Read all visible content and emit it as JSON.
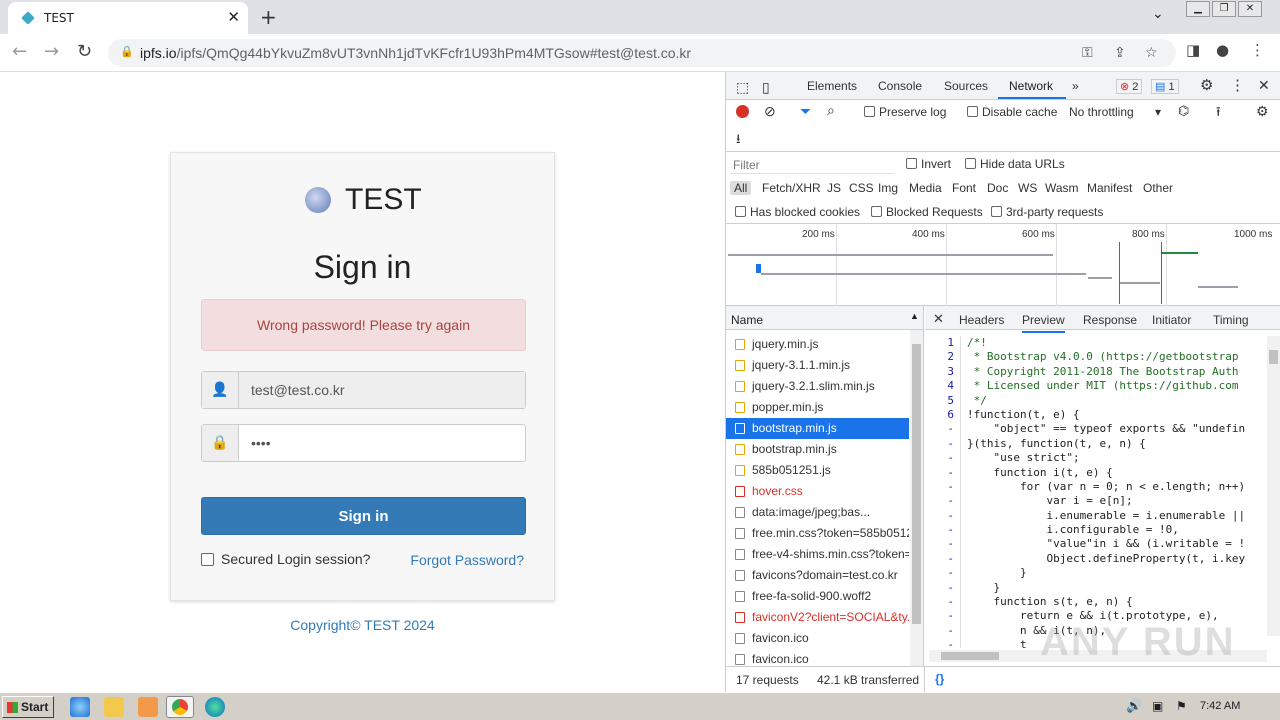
{
  "browser": {
    "tab_title": "TEST",
    "url_host": "ipfs.io",
    "url_path": "/ipfs/QmQg44bYkvuZm8vUT3vnNh1jdTvKFcfr1U93hPm4MTGsow#test@test.co.kr"
  },
  "login": {
    "brand": "TEST",
    "heading": "Sign in",
    "alert": "Wrong password! Please try again",
    "email_value": "test@test.co.kr",
    "password_mask": "••••",
    "signin_label": "Sign in",
    "remember_label": "Secured Login session?",
    "forgot_label": "Forgot Password?",
    "copyright": "Copyright© TEST 2024"
  },
  "devtools": {
    "tabs": [
      "Elements",
      "Console",
      "Sources",
      "Network"
    ],
    "error_count": "2",
    "message_count": "1",
    "preserve_log": "Preserve log",
    "disable_cache": "Disable cache",
    "throttling": "No throttling",
    "filter_placeholder": "Filter",
    "invert": "Invert",
    "hide_data_urls": "Hide data URLs",
    "type_filters": [
      "All",
      "Fetch/XHR",
      "JS",
      "CSS",
      "Img",
      "Media",
      "Font",
      "Doc",
      "WS",
      "Wasm",
      "Manifest",
      "Other"
    ],
    "has_blocked_cookies": "Has blocked cookies",
    "blocked_requests": "Blocked Requests",
    "third_party": "3rd-party requests",
    "timeline_ticks": [
      "200 ms",
      "400 ms",
      "600 ms",
      "800 ms",
      "1000 ms"
    ],
    "name_header": "Name",
    "requests": [
      {
        "name": "jquery.min.js",
        "kind": "js"
      },
      {
        "name": "jquery-3.1.1.min.js",
        "kind": "js"
      },
      {
        "name": "jquery-3.2.1.slim.min.js",
        "kind": "js"
      },
      {
        "name": "popper.min.js",
        "kind": "js"
      },
      {
        "name": "bootstrap.min.js",
        "kind": "sel"
      },
      {
        "name": "bootstrap.min.js",
        "kind": "js"
      },
      {
        "name": "585b051251.js",
        "kind": "js"
      },
      {
        "name": "hover.css",
        "kind": "err"
      },
      {
        "name": "data:image/jpeg;bas...",
        "kind": "img"
      },
      {
        "name": "free.min.css?token=585b0512",
        "kind": "doc"
      },
      {
        "name": "free-v4-shims.min.css?token=",
        "kind": "doc"
      },
      {
        "name": "favicons?domain=test.co.kr",
        "kind": "img"
      },
      {
        "name": "free-fa-solid-900.woff2",
        "kind": "font"
      },
      {
        "name": "faviconV2?client=SOCIAL&ty...",
        "kind": "err"
      },
      {
        "name": "favicon.ico",
        "kind": "doc"
      },
      {
        "name": "favicon.ico",
        "kind": "doc"
      }
    ],
    "preview_tabs": [
      "Headers",
      "Preview",
      "Response",
      "Initiator",
      "Timing"
    ],
    "code_lines": [
      {
        "n": "1",
        "t": "/*!"
      },
      {
        "n": "2",
        "t": " * Bootstrap v4.0.0 (https://getbootstrap"
      },
      {
        "n": "3",
        "t": " * Copyright 2011-2018 The Bootstrap Auth"
      },
      {
        "n": "4",
        "t": " * Licensed under MIT (https://github.com"
      },
      {
        "n": "5",
        "t": " */"
      },
      {
        "n": "6",
        "t": "!function(t, e) {"
      },
      {
        "n": "-",
        "t": "    \"object\" == typeof exports && \"undefin"
      },
      {
        "n": "-",
        "t": "}(this, function(t, e, n) {"
      },
      {
        "n": "-",
        "t": "    \"use strict\";"
      },
      {
        "n": "-",
        "t": "    function i(t, e) {"
      },
      {
        "n": "-",
        "t": "        for (var n = 0; n < e.length; n++)"
      },
      {
        "n": "-",
        "t": "            var i = e[n];"
      },
      {
        "n": "-",
        "t": "            i.enumerable = i.enumerable ||"
      },
      {
        "n": "-",
        "t": "            i.configurable = !0,"
      },
      {
        "n": "-",
        "t": "            \"value\"in i && (i.writable = !"
      },
      {
        "n": "-",
        "t": "            Object.defineProperty(t, i.key"
      },
      {
        "n": "-",
        "t": "        }"
      },
      {
        "n": "-",
        "t": "    }"
      },
      {
        "n": "-",
        "t": "    function s(t, e, n) {"
      },
      {
        "n": "-",
        "t": "        return e && i(t.prototype, e),"
      },
      {
        "n": "-",
        "t": "        n && i(t, n),"
      },
      {
        "n": "-",
        "t": "        t"
      }
    ],
    "status_requests": "17 requests",
    "status_transferred": "42.1 kB transferred",
    "pretty_print": "{}"
  },
  "taskbar": {
    "start": "Start",
    "clock": "7:42 AM"
  },
  "watermark": "ANY RUN"
}
